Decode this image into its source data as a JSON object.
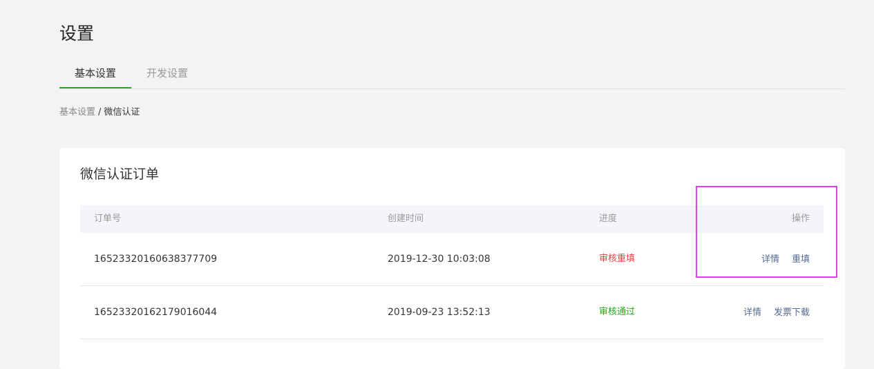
{
  "page": {
    "title": "设置"
  },
  "tabs": [
    {
      "label": "基本设置",
      "active": true
    },
    {
      "label": "开发设置",
      "active": false
    }
  ],
  "breadcrumb": {
    "parent": "基本设置",
    "separator": "/",
    "current": "微信认证"
  },
  "card": {
    "title": "微信认证订单",
    "columns": {
      "order": "订单号",
      "time": "创建时间",
      "status": "进度",
      "ops": "操作"
    },
    "rows": [
      {
        "order": "16523320160638377709",
        "time": "2019-12-30 10:03:08",
        "status": "审核重填",
        "status_color": "#e64340",
        "actions": [
          "详情",
          "重填"
        ]
      },
      {
        "order": "16523320162179016044",
        "time": "2019-09-23 13:52:13",
        "status": "审核通过",
        "status_color": "#1aad19",
        "actions": [
          "详情",
          "发票下载"
        ]
      }
    ]
  },
  "colors": {
    "accent": "#1aad19",
    "link": "#576b95",
    "highlight": "#e040e8",
    "background": "#f2f3f5"
  }
}
